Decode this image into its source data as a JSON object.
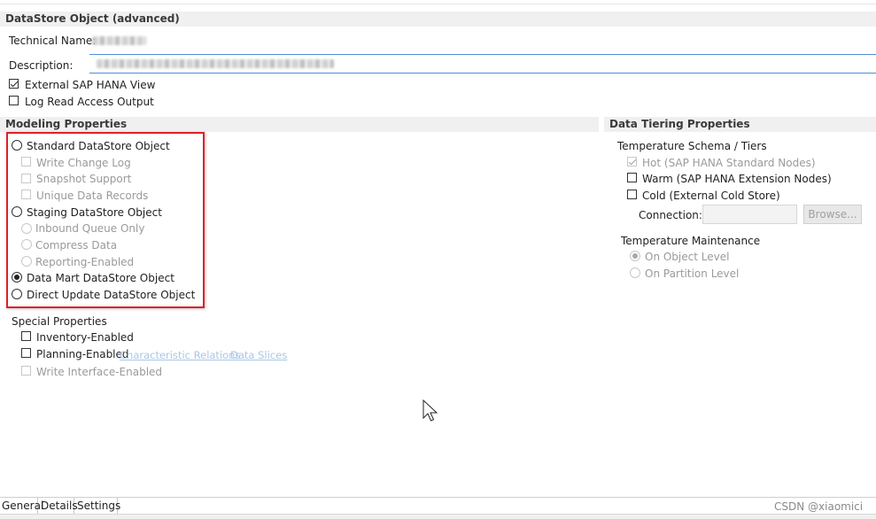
{
  "general": {
    "title": "DataStore Object (advanced)",
    "technical_name_label": "Technical Name:",
    "description_label": "Description:",
    "external_view_label": "External SAP HANA View",
    "external_view_checked": true,
    "log_read_label": "Log Read Access Output",
    "log_read_checked": false
  },
  "modeling": {
    "title": "Modeling Properties",
    "standard": "Standard DataStore Object",
    "write_change_log": "Write Change Log",
    "snapshot_support": "Snapshot Support",
    "unique_data_records": "Unique Data Records",
    "staging": "Staging DataStore Object",
    "inbound_queue_only": "Inbound Queue Only",
    "compress_data": "Compress Data",
    "reporting_enabled": "Reporting-Enabled",
    "data_mart": "Data Mart DataStore Object",
    "direct_update": "Direct Update DataStore Object",
    "selected": "data_mart",
    "highlight_color": "#e0202a"
  },
  "special": {
    "title": "Special Properties",
    "inventory": "Inventory-Enabled",
    "planning": "Planning-Enabled",
    "characteristic_relations": "Characteristic Relations",
    "data_slices": "Data Slices",
    "write_interface": "Write Interface-Enabled"
  },
  "tiering": {
    "title": "Data Tiering Properties",
    "schema_label": "Temperature Schema / Tiers",
    "hot": "Hot (SAP HANA Standard Nodes)",
    "hot_checked": true,
    "warm": "Warm (SAP HANA Extension Nodes)",
    "warm_checked": false,
    "cold": "Cold (External Cold Store)",
    "cold_checked": false,
    "connection_label": "Connection:",
    "connection_value": "",
    "browse_label": "Browse...",
    "maintenance_label": "Temperature Maintenance",
    "object_level": "On Object Level",
    "partition_level": "On Partition Level",
    "maintenance_selected": "object_level"
  },
  "tabs": {
    "general": "General",
    "details": "Details",
    "settings": "Settings",
    "active": "general"
  },
  "watermark": "CSDN @xiaomici",
  "colors": {
    "accent_line": "#4a90d9",
    "link": "#a9c6e6",
    "section_bg": "#f0f0f0"
  }
}
